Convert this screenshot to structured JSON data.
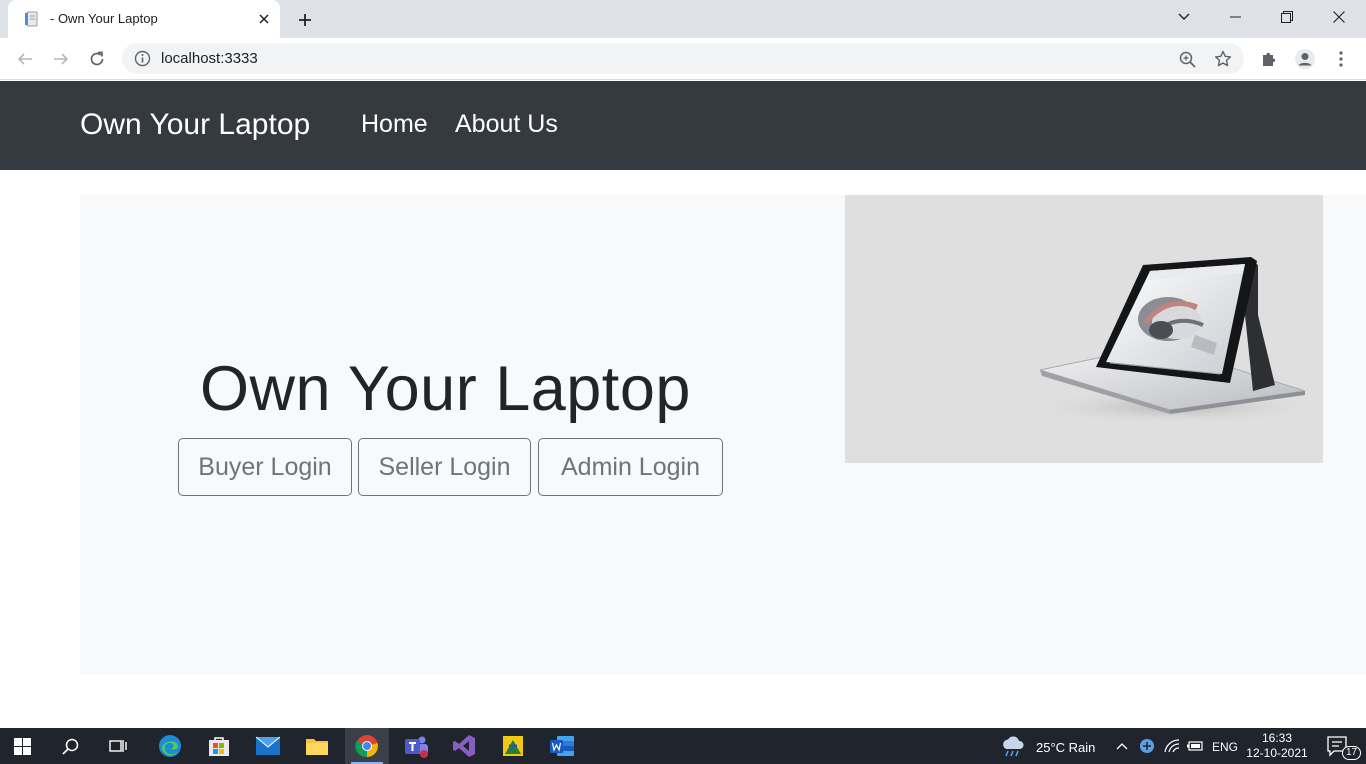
{
  "browser": {
    "tab_title": "- Own Your Laptop",
    "url": "localhost:3333"
  },
  "navbar": {
    "brand": "Own Your Laptop",
    "links": [
      "Home",
      "About Us"
    ]
  },
  "hero": {
    "title": "Own Your Laptop",
    "buttons": [
      "Buyer Login",
      "Seller Login",
      "Admin Login"
    ]
  },
  "taskbar": {
    "weather": "25°C  Rain",
    "language": "ENG",
    "time": "16:33",
    "date": "12-10-2021",
    "notifications": "17"
  },
  "colors": {
    "navbar_bg": "#343a40",
    "hero_bg": "#f8f9fa",
    "button_border": "#6c757d",
    "title_text": "#212529"
  }
}
